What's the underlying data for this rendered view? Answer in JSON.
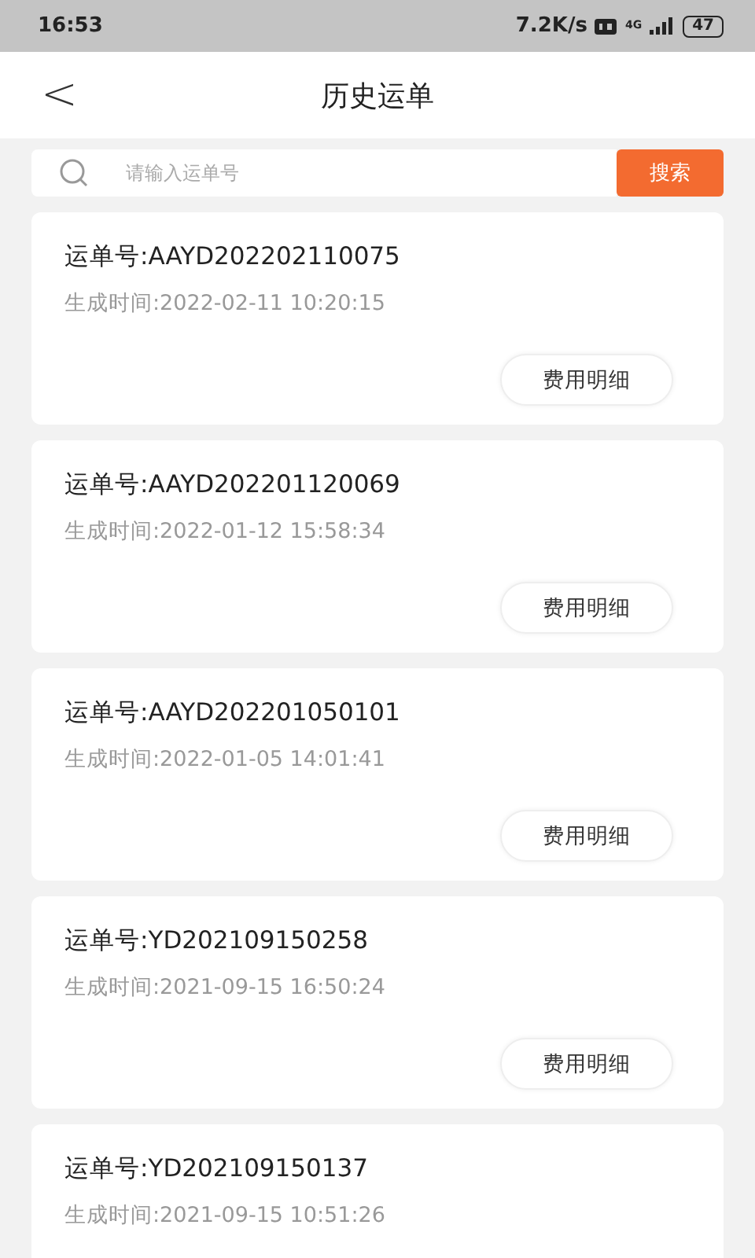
{
  "status_bar": {
    "time": "16:53",
    "speed": "7.2K/s",
    "network": "4G",
    "battery": "47"
  },
  "header": {
    "back": "<",
    "title": "历史运单"
  },
  "search": {
    "placeholder": "请输入运单号",
    "button": "搜索"
  },
  "orders": [
    {
      "number": "运单号:AAYD202202110075",
      "time": "生成时间:2022-02-11 10:20:15",
      "button": "费用明细"
    },
    {
      "number": "运单号:AAYD202201120069",
      "time": "生成时间:2022-01-12 15:58:34",
      "button": "费用明细"
    },
    {
      "number": "运单号:AAYD202201050101",
      "time": "生成时间:2022-01-05 14:01:41",
      "button": "费用明细"
    },
    {
      "number": "运单号:YD202109150258",
      "time": "生成时间:2021-09-15 16:50:24",
      "button": "费用明细"
    },
    {
      "number": "运单号:YD202109150137",
      "time": "生成时间:2021-09-15 10:51:26"
    }
  ]
}
